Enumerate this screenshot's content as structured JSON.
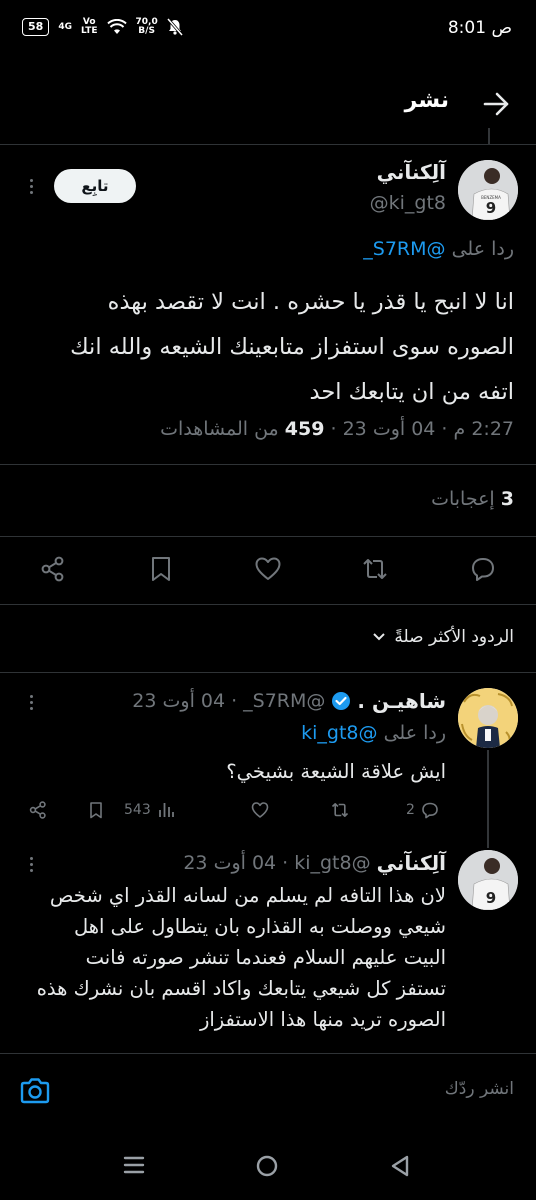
{
  "status_bar": {
    "time": "8:01",
    "am_pm": "ص",
    "battery": "58",
    "network_4g": "4G",
    "volte_top": "Vo",
    "volte_bottom": "LTE",
    "speed_value": "70,0",
    "speed_unit": "B/S"
  },
  "header": {
    "title": "نشر",
    "back_icon": "arrow-back-icon"
  },
  "main_tweet": {
    "author_name": "آلِكنآني",
    "author_handle": "@ki_gt8",
    "follow_label": "تابِع",
    "replying_prefix": "ردا على",
    "replying_handle": "@S7RM_",
    "body_lines": [
      "انا لا انبح يا قذر يا حشره .  انت لا تقصد بهذه",
      "الصوره سوى استفزاز متابعينك الشيعه والله انك",
      "اتفه من ان يتابعك احد"
    ],
    "time": "2:27 م",
    "date": "04 أوت 23",
    "views_count": "459",
    "views_label": "من المشاهدات",
    "likes_count": "3",
    "likes_label": "إعجابات"
  },
  "sort_label": "الردود الأكثر صلةً",
  "replies": [
    {
      "author_name": "شاهيـن .",
      "verified": true,
      "author_handle": "@S7RM_",
      "date": "04 أوت 23",
      "replying_prefix": "ردا على",
      "replying_handle": "@ki_gt8",
      "body_lines": [
        "ايش علاقة الشيعة بشيخي؟"
      ],
      "reply_count": "2",
      "views": "543"
    },
    {
      "author_name": "آلِكنآني",
      "author_handle": "@ki_gt8",
      "date": "04 أوت 23",
      "body_lines": [
        "لان هذا التافه لم يسلم من لسانه القذر اي شخص",
        "شيعي ووصلت به القذاره بان يتطاول على  اهل",
        "البيت عليهم السلام فعندما تنشر صورته فانت",
        "تستفز كل شيعي يتابعك واكاد اقسم بان نشرك هذه",
        "الصوره تريد منها هذا الاستفزاز"
      ]
    }
  ],
  "composer": {
    "placeholder": "انشر ردّك"
  },
  "colors": {
    "background": "#000000",
    "accent": "#1d9bf0",
    "muted": "#71767b",
    "text": "#e7e9ea"
  }
}
